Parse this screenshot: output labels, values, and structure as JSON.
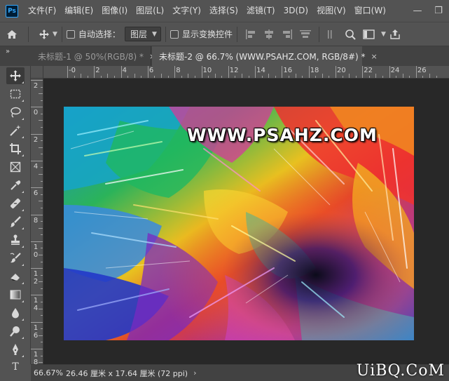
{
  "app": {
    "logo_text": "Ps"
  },
  "menu": {
    "items": [
      "文件(F)",
      "编辑(E)",
      "图像(I)",
      "图层(L)",
      "文字(Y)",
      "选择(S)",
      "滤镜(T)",
      "3D(D)",
      "视图(V)",
      "窗口(W)"
    ]
  },
  "window_controls": {
    "minimize": "—",
    "restore": "❐"
  },
  "options_bar": {
    "auto_select_label": "自动选择：",
    "auto_select_checked": false,
    "target_value": "图层",
    "show_transform_label": "显示变换控件",
    "show_transform_checked": false
  },
  "tabs": [
    {
      "label": "未标题-1 @ 50%(RGB/8) *",
      "active": false,
      "close": "×"
    },
    {
      "label": "未标题-2 @ 66.7% (WWW.PSAHZ.COM, RGB/8#) *",
      "active": true,
      "close": "×"
    }
  ],
  "panel_collapse": "»",
  "tools": [
    {
      "name": "move-tool",
      "icon": "move-icon"
    },
    {
      "name": "marquee-tool",
      "icon": "rect-marquee-icon"
    },
    {
      "name": "lasso-tool",
      "icon": "lasso-icon"
    },
    {
      "name": "magic-wand-tool",
      "icon": "magic-wand-icon"
    },
    {
      "name": "crop-tool",
      "icon": "crop-icon"
    },
    {
      "name": "frame-tool",
      "icon": "frame-icon"
    },
    {
      "name": "eyedropper-tool",
      "icon": "eyedropper-icon"
    },
    {
      "name": "healing-tool",
      "icon": "bandage-icon"
    },
    {
      "name": "brush-tool",
      "icon": "brush-icon"
    },
    {
      "name": "stamp-tool",
      "icon": "stamp-icon"
    },
    {
      "name": "history-brush-tool",
      "icon": "history-brush-icon"
    },
    {
      "name": "eraser-tool",
      "icon": "eraser-icon"
    },
    {
      "name": "gradient-tool",
      "icon": "gradient-icon"
    },
    {
      "name": "blur-tool",
      "icon": "drop-icon"
    },
    {
      "name": "dodge-tool",
      "icon": "dodge-icon"
    },
    {
      "name": "pen-tool",
      "icon": "pen-icon"
    },
    {
      "name": "type-tool",
      "icon": "type-icon",
      "label": "T"
    }
  ],
  "ruler": {
    "top_labels": [
      "-0",
      "2",
      "4",
      "6",
      "8",
      "10",
      "12",
      "14",
      "16",
      "18",
      "20",
      "22",
      "24",
      "26"
    ],
    "left_labels": [
      "2",
      "0",
      "2",
      "4",
      "6",
      "8",
      "1\n0",
      "1\n2",
      "1\n4",
      "1\n6",
      "1\n8"
    ]
  },
  "canvas": {
    "overlay_text": "WWW.PSAHZ.COM"
  },
  "status": {
    "zoom": "66.67%",
    "doc_info": "26.46 厘米 x 17.64 厘米 (72 ppi)",
    "arrow": "›"
  },
  "watermark_logo": "UiBQ.CoM",
  "colors": {
    "ui_bg": "#535353",
    "tab_bg": "#424242",
    "pasteboard": "#282828"
  }
}
